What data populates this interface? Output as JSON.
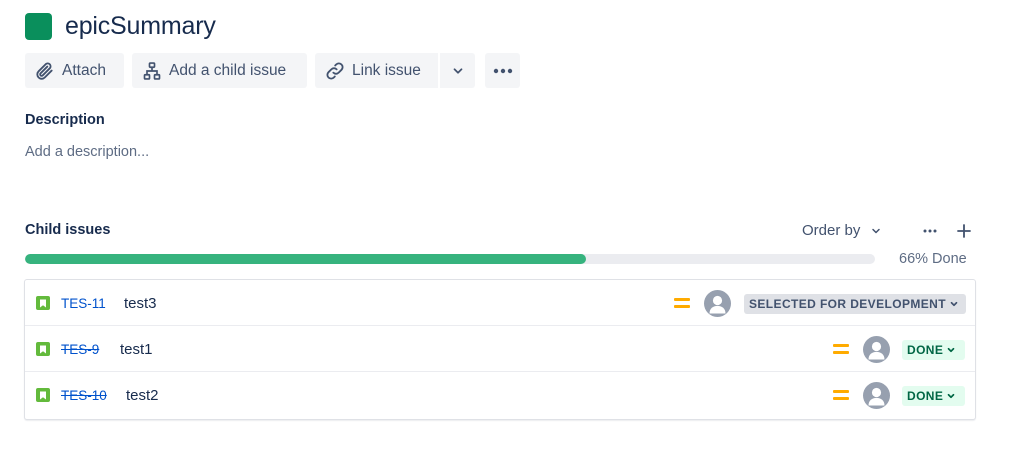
{
  "header": {
    "title": "epicSummary",
    "icon": "epic-icon",
    "icon_color": "#0a8f5c"
  },
  "toolbar": {
    "attach_label": "Attach",
    "add_child_label": "Add a child issue",
    "link_label": "Link issue"
  },
  "description": {
    "title": "Description",
    "placeholder": "Add a description..."
  },
  "child_issues": {
    "title": "Child issues",
    "order_by_label": "Order by",
    "progress_fraction": 0.66,
    "progress_text": "66% Done",
    "progress_color": "#36b37e",
    "items": [
      {
        "key": "TES-11",
        "summary": "test3",
        "priority": "medium",
        "status": "SELECTED FOR DEVELOPMENT",
        "done": false
      },
      {
        "key": "TES-9",
        "summary": "test1",
        "priority": "medium",
        "status": "DONE",
        "done": true
      },
      {
        "key": "TES-10",
        "summary": "test2",
        "priority": "medium",
        "status": "DONE",
        "done": true
      }
    ]
  },
  "colors": {
    "link": "#0052cc",
    "story": "#63ba3c",
    "priority_medium": "#ffab00",
    "status_done_bg": "#e3fcef",
    "status_done_text": "#006644",
    "status_default_bg": "#dfe1e6"
  }
}
